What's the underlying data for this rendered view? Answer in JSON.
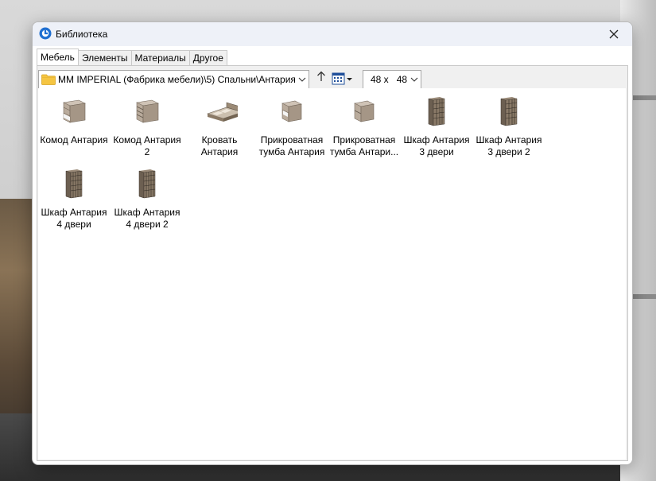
{
  "window": {
    "title": "Библиотека"
  },
  "tabs": [
    {
      "label": "Мебель",
      "active": true
    },
    {
      "label": "Элементы",
      "active": false
    },
    {
      "label": "Материалы",
      "active": false
    },
    {
      "label": "Другое",
      "active": false
    }
  ],
  "toolbar": {
    "path": "MM IMPERIAL (Фабрика мебели)\\5) Спальни\\Антария",
    "size_w": "48 x",
    "size_h": "48"
  },
  "items": [
    {
      "line1": "Комод Антария",
      "line2": "",
      "icon": "dresser-icon"
    },
    {
      "line1": "Комод Антария",
      "line2": "2",
      "icon": "dresser-icon"
    },
    {
      "line1": "Кровать",
      "line2": "Антария",
      "icon": "bed-icon"
    },
    {
      "line1": "Прикроватная",
      "line2": "тумба Антария",
      "icon": "nightstand-icon"
    },
    {
      "line1": "Прикроватная",
      "line2": "тумба Антари...",
      "icon": "nightstand-icon"
    },
    {
      "line1": "Шкаф Антария",
      "line2": "3 двери",
      "icon": "wardrobe-icon"
    },
    {
      "line1": "Шкаф Антария",
      "line2": "3 двери 2",
      "icon": "wardrobe-icon"
    },
    {
      "line1": "Шкаф Антария",
      "line2": "4 двери",
      "icon": "wardrobe-icon"
    },
    {
      "line1": "Шкаф Антария",
      "line2": "4 двери 2",
      "icon": "wardrobe-icon"
    }
  ]
}
